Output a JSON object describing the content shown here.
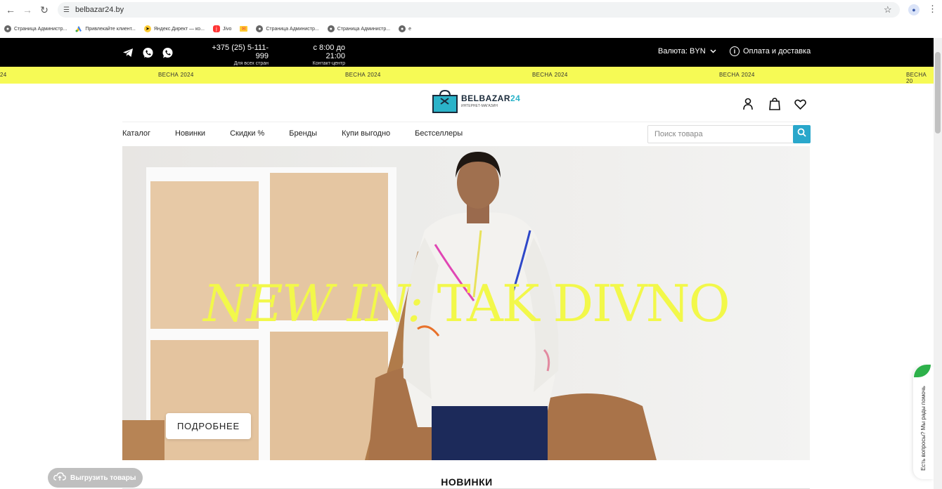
{
  "browser": {
    "url": "belbazar24.by",
    "bookmarks": [
      {
        "label": "Страница Администр...",
        "icon": "globe-icon"
      },
      {
        "label": "Привлекайте клиент...",
        "icon": "google-ads-icon"
      },
      {
        "label": "Яндекс.Директ — ко...",
        "icon": "yandex-direct-icon"
      },
      {
        "label": "Jivo",
        "icon": "jivo-icon"
      },
      {
        "label": "",
        "icon": "mail-icon"
      },
      {
        "label": "Страница Администр...",
        "icon": "globe-icon"
      },
      {
        "label": "Страница Администр...",
        "icon": "globe-icon"
      },
      {
        "label": "e",
        "icon": "globe-icon"
      }
    ]
  },
  "topbar": {
    "phone": "+375 (25) 5-111-999",
    "phone_note": "Для всех стран",
    "hours": "с 8:00 до 21:00",
    "hours_note": "Контакт-центр",
    "currency": "Валюта: BYN",
    "delivery": "Оплата и доставка"
  },
  "marquee": {
    "text": "ВЕСНА 2024",
    "partial_left": "24",
    "partial_right": "ВЕСНА 20"
  },
  "logo": {
    "name_part1": "BELBAZAR",
    "name_part2": "24",
    "subtitle": "ИНТЕРНЕТ-МАГАЗИН"
  },
  "nav": {
    "items": [
      "Каталог",
      "Новинки",
      "Скидки %",
      "Бренды",
      "Купи выгодно",
      "Бестселлеры"
    ]
  },
  "search": {
    "placeholder": "Поиск товара"
  },
  "hero": {
    "title_italic": "NEW IN:",
    "title_rest": " TAK DIVNO",
    "button": "ПОДРОБНЕЕ"
  },
  "section": {
    "title": "НОВИНКИ"
  },
  "upload": {
    "label": "Выгрузить товары"
  },
  "chat": {
    "label": "Есть вопросы? Мы рады помочь"
  },
  "colors": {
    "topbar": "#000000",
    "marquee": "#f6fa55",
    "accent": "#29a7cb",
    "hero_title": "#f2f84a"
  }
}
